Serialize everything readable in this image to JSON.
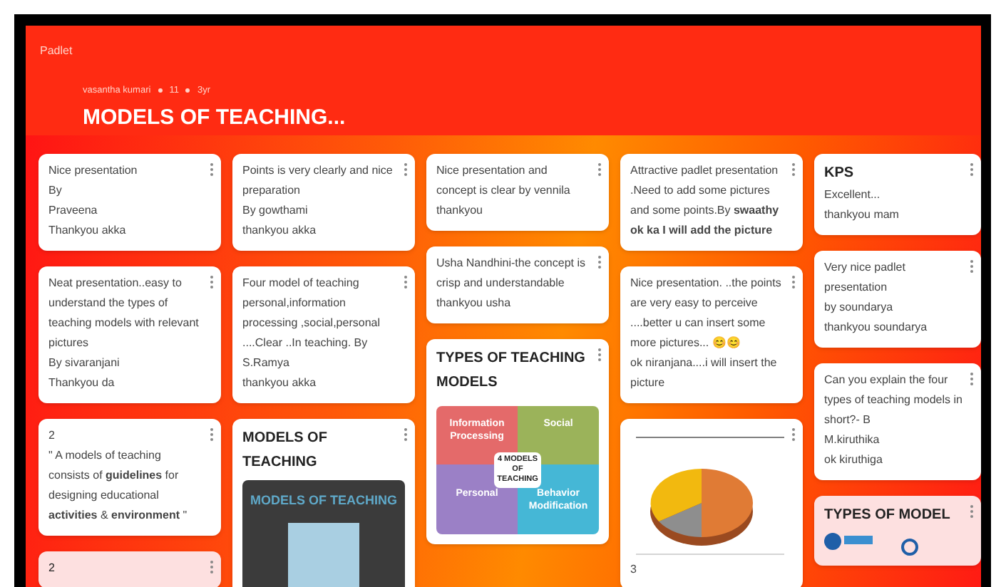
{
  "app": {
    "logo": "Padlet"
  },
  "board": {
    "meta": [
      "vasantha kumari",
      "11",
      "3yr"
    ],
    "title": "MODELS OF TEACHING..."
  },
  "columns": [
    {
      "cards": [
        {
          "kind": "text",
          "lines": [
            "Nice presentation",
            "By",
            "Praveena",
            "Thankyou akka"
          ]
        },
        {
          "kind": "text",
          "lines": [
            "Neat presentation..easy to understand the types of teaching models with relevant pictures",
            "By sivaranjani",
            "Thankyou da"
          ]
        },
        {
          "kind": "text",
          "lines": [
            "2",
            "\" A models of teaching consists of **guidelines** for designing educational **activities** & **environment** \""
          ]
        },
        {
          "kind": "text",
          "color": "#fde0e0",
          "heading": "2"
        }
      ]
    },
    {
      "cards": [
        {
          "kind": "text",
          "lines": [
            "Points is very clearly  and nice preparation",
            "By gowthami",
            "thankyou akka"
          ]
        },
        {
          "kind": "text",
          "lines": [
            "Four model of teaching personal,information processing  ,social,personal ....Clear ..In teaching. By S.Ramya",
            "thankyou akka"
          ]
        },
        {
          "kind": "slide",
          "heading": "MODELS OF TEACHING",
          "slide_title": "MODELS OF TEACHING"
        }
      ]
    },
    {
      "cards": [
        {
          "kind": "text",
          "lines": [
            "Nice presentation and concept is clear by vennila",
            "thankyou"
          ]
        },
        {
          "kind": "text",
          "lines": [
            "Usha Nandhini-the concept is crisp and understandable",
            "thankyou usha"
          ]
        },
        {
          "kind": "quadrants",
          "heading": "TYPES OF TEACHING MODELS",
          "quadrants": [
            "Information Processing",
            "Social",
            "Personal",
            "Behavior Modification"
          ],
          "center": "4 MODELS OF TEACHING"
        }
      ]
    },
    {
      "cards": [
        {
          "kind": "text",
          "lines": [
            "Attractive padlet presentation .Need to add some pictures and some points.By **swaathy**",
            "**ok ka I will add the picture**"
          ]
        },
        {
          "kind": "text",
          "lines": [
            "Nice presentation. ..the points are very easy to perceive ....better u can insert some more pictures... 😊😊",
            "ok niranjana....i will insert the picture"
          ]
        },
        {
          "kind": "pie",
          "lines": [
            "3"
          ]
        }
      ]
    },
    {
      "cards": [
        {
          "kind": "text",
          "heading": "KPS",
          "lines": [
            "Excellent...",
            "thankyou mam"
          ]
        },
        {
          "kind": "text",
          "lines": [
            "Very nice padlet presentation",
            "by soundarya",
            "thankyou soundarya"
          ]
        },
        {
          "kind": "text",
          "lines": [
            "Can you explain the four types of teaching models in short?- B",
            "M.kiruthika",
            "ok kiruthiga"
          ]
        },
        {
          "kind": "diagram",
          "color": "#fde0e0",
          "heading": "TYPES OF MODEL"
        }
      ]
    }
  ]
}
